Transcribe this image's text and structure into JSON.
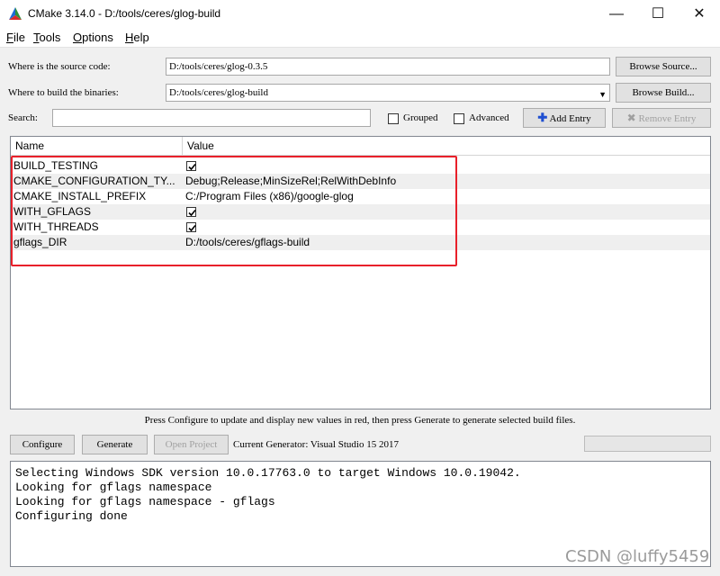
{
  "window": {
    "title": "CMake 3.14.0 - D:/tools/ceres/glog-build",
    "minimize": "—",
    "maximize": "☐",
    "close": "✕"
  },
  "menu": [
    {
      "label": "File",
      "accel": "F",
      "rest": "ile"
    },
    {
      "label": "Tools",
      "accel": "T",
      "rest": "ools"
    },
    {
      "label": "Options",
      "accel": "O",
      "rest": "ptions"
    },
    {
      "label": "Help",
      "accel": "H",
      "rest": "elp"
    }
  ],
  "source": {
    "label": "Where is the source code:",
    "value": "D:/tools/ceres/glog-0.3.5",
    "browse": "Browse Source..."
  },
  "build": {
    "label": "Where to build the binaries:",
    "value": "D:/tools/ceres/glog-build",
    "browse": "Browse Build..."
  },
  "search": {
    "label": "Search:",
    "value": "",
    "grouped": "Grouped",
    "advanced": "Advanced",
    "add_entry": "Add Entry",
    "remove_entry": "Remove Entry"
  },
  "table": {
    "headers": [
      "Name",
      "Value"
    ],
    "rows": [
      {
        "name": "BUILD_TESTING",
        "value": "",
        "checkbox": true,
        "checked": true
      },
      {
        "name": "CMAKE_CONFIGURATION_TY...",
        "value": "Debug;Release;MinSizeRel;RelWithDebInfo",
        "checkbox": false
      },
      {
        "name": "CMAKE_INSTALL_PREFIX",
        "value": "C:/Program Files (x86)/google-glog",
        "checkbox": false
      },
      {
        "name": "WITH_GFLAGS",
        "value": "",
        "checkbox": true,
        "checked": true
      },
      {
        "name": "WITH_THREADS",
        "value": "",
        "checkbox": true,
        "checked": true
      },
      {
        "name": "gflags_DIR",
        "value": "D:/tools/ceres/gflags-build",
        "checkbox": false
      }
    ]
  },
  "status_message": "Press Configure to update and display new values in red, then press Generate to generate selected build files.",
  "actions": {
    "configure": "Configure",
    "generate": "Generate",
    "open_project": "Open Project",
    "generator": "Current Generator: Visual Studio 15 2017"
  },
  "output": [
    "Selecting Windows SDK version 10.0.17763.0 to target Windows 10.0.19042.",
    "Looking for gflags namespace",
    "Looking for gflags namespace - gflags",
    "Configuring done"
  ],
  "watermark": "CSDN @luffy5459",
  "colors": {
    "highlight": "#e8202a",
    "alt_row": "#efefef"
  }
}
